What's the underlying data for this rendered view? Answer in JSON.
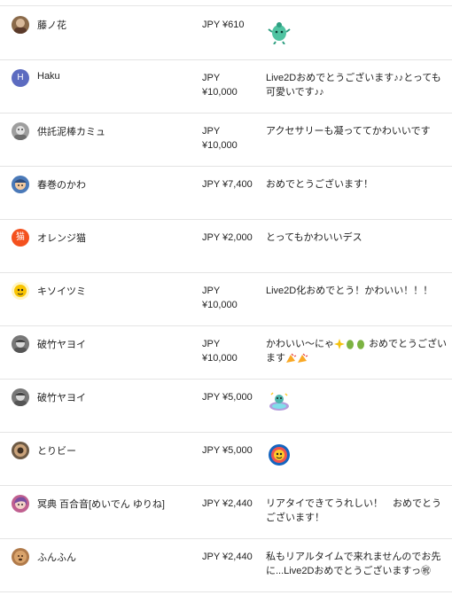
{
  "donations": [
    {
      "name": "藤ノ花",
      "currency": "JPY",
      "amount": "¥610",
      "message": "",
      "sticker": "green-creature-sticker",
      "avatar_color": "#8a6a4a"
    },
    {
      "name": "Haku",
      "currency": "JPY",
      "amount": "¥10,000",
      "message": "Live2Dおめでとうございます♪♪とっても可愛いです♪♪",
      "avatar_letter": "H",
      "avatar_color": "#5c6bc0"
    },
    {
      "name": "供託泥棒カミュ",
      "currency": "JPY",
      "amount": "¥10,000",
      "message": "アクセサリーも凝っててかわいいです",
      "avatar_color": "#9e9e9e"
    },
    {
      "name": "春巻のかわ",
      "currency": "JPY",
      "amount": "¥7,400",
      "message": "おめでとうございます！",
      "avatar_color": "#4a79b8"
    },
    {
      "name": "オレンジ猫",
      "currency": "JPY",
      "amount": "¥2,000",
      "message": "とってもかわいいデス",
      "avatar_letter": "猫",
      "avatar_color": "#f4511e"
    },
    {
      "name": "キソイツミ",
      "currency": "JPY",
      "amount": "¥10,000",
      "message": "Live2D化おめでとう！かわいい！！！",
      "avatar_color": "#f9c400"
    },
    {
      "name": "破竹ヤヨイ",
      "currency": "JPY",
      "amount": "¥10,000",
      "message": "かわいい〜にゃ",
      "message_after": "おめでとうございます",
      "avatar_color": "#777777"
    },
    {
      "name": "破竹ヤヨイ",
      "currency": "JPY",
      "amount": "¥5,000",
      "message": "",
      "sticker": "rainbow-sticker",
      "avatar_color": "#777777"
    },
    {
      "name": "とりビー",
      "currency": "JPY",
      "amount": "¥5,000",
      "message": "",
      "sticker": "round-badge-sticker",
      "avatar_color": "#6d5a45"
    },
    {
      "name": "冥典 百合音[めいでん ゆりね]",
      "currency": "JPY",
      "amount": "¥2,440",
      "message": "リアタイできてうれしい！　おめでとうございます！",
      "avatar_color": "#c06090"
    },
    {
      "name": "ふんふん",
      "currency": "JPY",
      "amount": "¥2,440",
      "message": "私もリアルタイムで来れませんのでお先に...Live2Dおめでとうございますっ㊗",
      "avatar_color": "#b07a4a"
    }
  ]
}
